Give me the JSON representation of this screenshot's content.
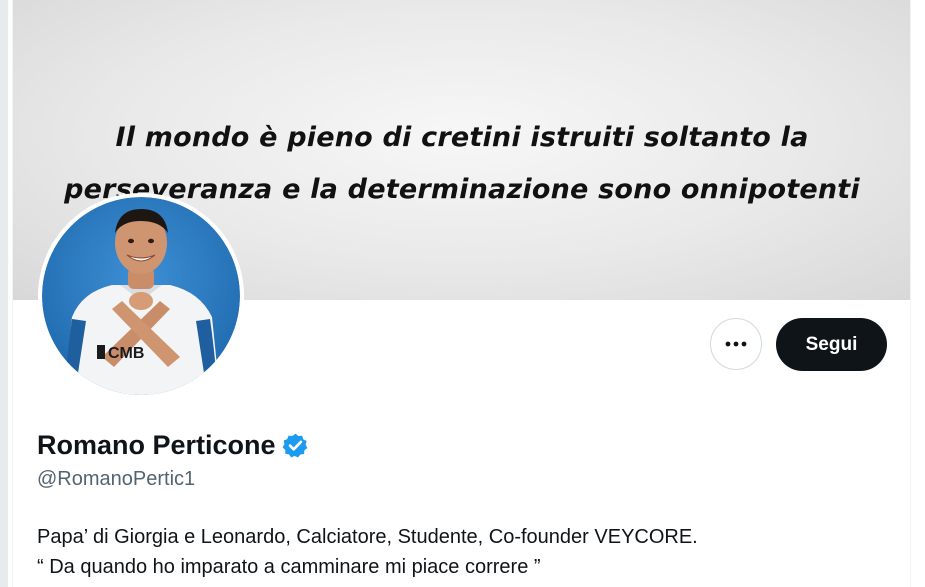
{
  "banner": {
    "quote_line_1": "Il mondo è pieno di cretini istruiti soltanto la",
    "quote_line_2": "perseveranza e la determinazione sono onnipotenti"
  },
  "avatar": {
    "shirt_text": "CMB"
  },
  "actions": {
    "more_icon": "more-horizontal-icon",
    "follow_label": "Segui"
  },
  "profile": {
    "display_name": "Romano Perticone",
    "verified_icon": "verified-badge-icon",
    "handle": "@RomanoPertic1",
    "bio_line_1": "Papa’ di Giorgia e Leonardo, Calciatore, Studente, Co-founder VEYCORE.",
    "bio_line_2": "“ Da quando ho imparato a camminare mi piace correre ”"
  },
  "colors": {
    "follow_bg": "#0f1419",
    "verified_blue": "#1d9bf0",
    "handle_gray": "#536471",
    "avatar_bg": "#2f7fc4"
  }
}
